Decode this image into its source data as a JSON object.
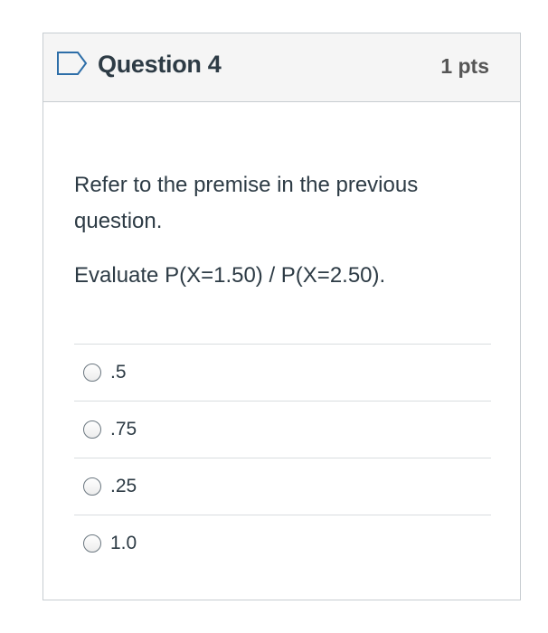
{
  "question": {
    "title": "Question 4",
    "points": "1 pts",
    "premise": "Refer to the premise in the previous question.",
    "prompt": "Evaluate P(X=1.50) / P(X=2.50).",
    "flag_icon": "flag-outline-icon"
  },
  "answers": [
    {
      "label": ".5"
    },
    {
      "label": ".75"
    },
    {
      "label": ".25"
    },
    {
      "label": "1.0"
    }
  ],
  "colors": {
    "text": "#2d3b45",
    "header_bg": "#f5f5f5",
    "border": "#c7cdd1",
    "points": "#555555"
  }
}
